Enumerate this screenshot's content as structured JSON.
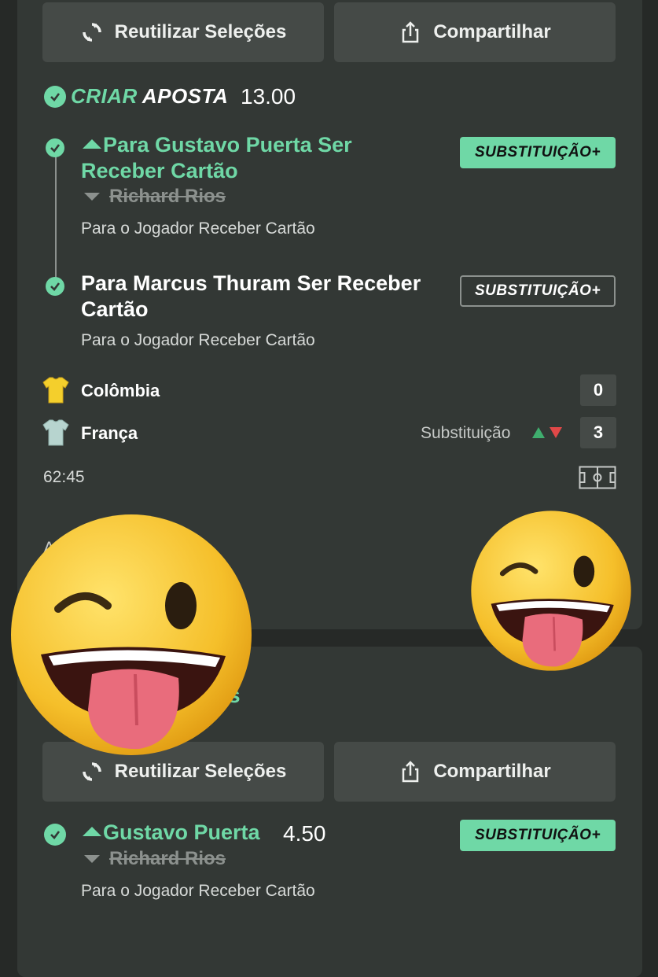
{
  "bet1": {
    "reuse_label": "Reutilizar Seleções",
    "share_label": "Compartilhar",
    "criar": "CRIAR",
    "aposta": "APOSTA",
    "odds": "13.00",
    "selections": [
      {
        "line1": "Para Gustavo Puerta Ser",
        "line2": "Receber Cartão",
        "replaced": "Richard Rios",
        "market": "Para o Jogador Receber Cartão",
        "badge": "SUBSTITUIÇÃO+"
      },
      {
        "line1": "Para Marcus Thuram Ser Receber",
        "line2": "Cartão",
        "market": "Para o Jogador Receber Cartão",
        "badge": "SUBSTITUIÇÃO+"
      }
    ],
    "teams": [
      {
        "name": "Colômbia",
        "score": "0"
      },
      {
        "name": "França",
        "score": "3"
      }
    ],
    "substitution_text": "Substituição",
    "time": "62:45",
    "partial_text": "A"
  },
  "bet2": {
    "partial_text": "s",
    "reuse_label": "Reutilizar Seleções",
    "share_label": "Compartilhar",
    "selection": {
      "name": "Gustavo Puerta",
      "odds": "4.50",
      "replaced": "Richard Rios",
      "market": "Para o Jogador Receber Cartão",
      "badge": "SUBSTITUIÇÃO+"
    }
  },
  "colors": {
    "accent": "#6fd8a6",
    "card": "#333835",
    "button": "#454a47",
    "background": "#262927",
    "arrow_up": "#3fae6e",
    "arrow_down": "#e04848"
  }
}
